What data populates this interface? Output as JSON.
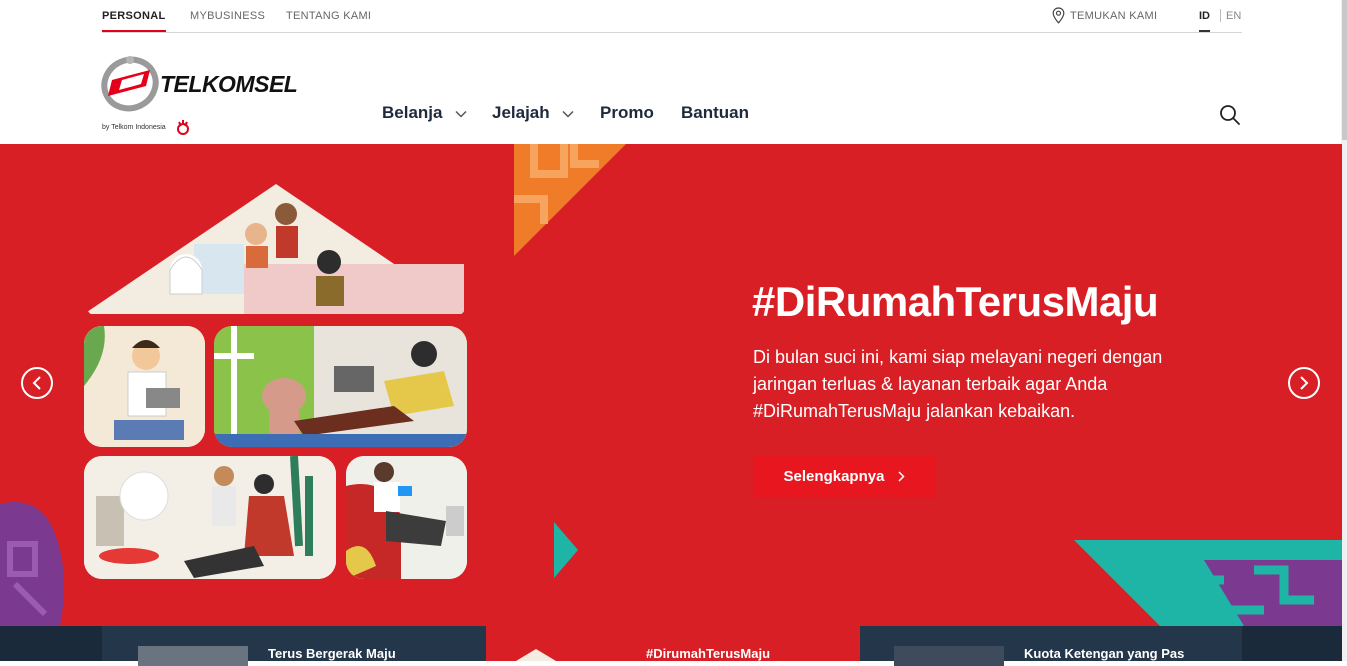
{
  "topbar": {
    "segments": [
      "PERSONAL",
      "MYBUSINESS",
      "TENTANG KAMI"
    ],
    "store_locator": "TEMUKAN KAMI",
    "languages": [
      "ID",
      "EN"
    ]
  },
  "brand": {
    "name": "TELKOMSEL",
    "tagline": "by Telkom Indonesia"
  },
  "nav": {
    "items": [
      "Belanja",
      "Jelajah",
      "Promo",
      "Bantuan"
    ]
  },
  "hero": {
    "title": "#DiRumahTerusMaju",
    "description": "Di bulan suci ini, kami siap melayani negeri dengan jaringan terluas & layanan terbaik agar Anda #DiRumahTerusMaju jalankan kebaikan.",
    "cta": "Selengkapnya"
  },
  "carousel": {
    "cards": [
      "Terus Bergerak Maju",
      "#DirumahTerusMaju",
      "Kuota Ketengan yang Pas"
    ]
  },
  "colors": {
    "brand_red": "#d81f26",
    "cta_red": "#e8161f",
    "navy": "#1e2a3c",
    "accent_orange": "#f07c2a",
    "accent_teal": "#1fb5a6",
    "accent_purple": "#7b3a8f"
  }
}
